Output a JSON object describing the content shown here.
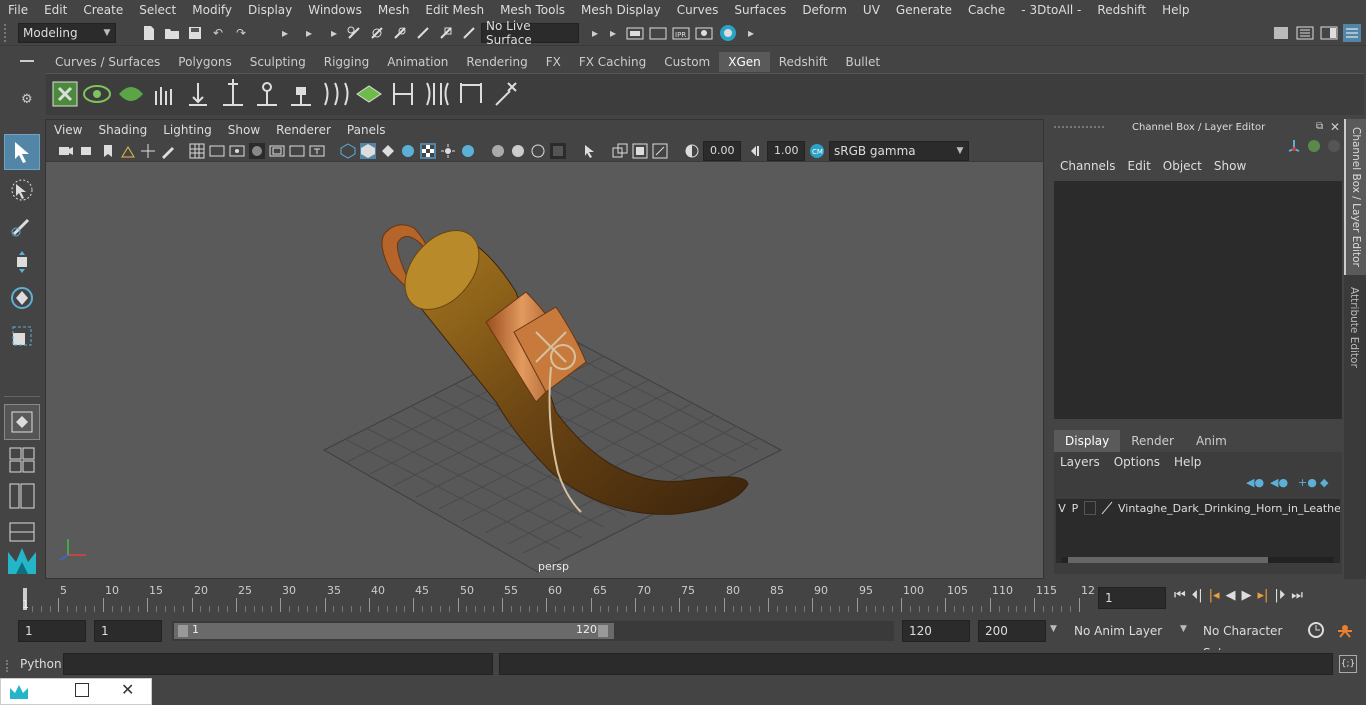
{
  "menubar": [
    "File",
    "Edit",
    "Create",
    "Select",
    "Modify",
    "Display",
    "Windows",
    "Mesh",
    "Edit Mesh",
    "Mesh Tools",
    "Mesh Display",
    "Curves",
    "Surfaces",
    "Deform",
    "UV",
    "Generate",
    "Cache",
    "- 3DtoAll -",
    "Redshift",
    "Help"
  ],
  "status": {
    "mode": "Modeling",
    "live_surface": "No Live Surface"
  },
  "shelf_tabs": [
    "Curves / Surfaces",
    "Polygons",
    "Sculpting",
    "Rigging",
    "Animation",
    "Rendering",
    "FX",
    "FX Caching",
    "Custom",
    "XGen",
    "Redshift",
    "Bullet"
  ],
  "shelf_active": "XGen",
  "viewport": {
    "menu": [
      "View",
      "Shading",
      "Lighting",
      "Show",
      "Renderer",
      "Panels"
    ],
    "exposure": "0.00",
    "gamma": "1.00",
    "colorspace": "sRGB gamma",
    "camera_label": "persp"
  },
  "channel_box": {
    "title": "Channel Box / Layer Editor",
    "menu": [
      "Channels",
      "Edit",
      "Object",
      "Show"
    ],
    "layer_tabs": [
      "Display",
      "Render",
      "Anim"
    ],
    "layer_tab_active": "Display",
    "layer_menu": [
      "Layers",
      "Options",
      "Help"
    ],
    "layer": {
      "v": "V",
      "p": "P",
      "name": "Vintaghe_Dark_Drinking_Horn_in_Leather_C"
    }
  },
  "side_tabs": [
    "Channel Box / Layer Editor",
    "Attribute Editor"
  ],
  "timeline": {
    "ticks": [
      "5",
      "10",
      "15",
      "20",
      "25",
      "30",
      "35",
      "40",
      "45",
      "50",
      "55",
      "60",
      "65",
      "70",
      "75",
      "80",
      "85",
      "90",
      "95",
      "100",
      "105",
      "110",
      "115",
      "12"
    ],
    "start_marker": "1",
    "current_frame": "1"
  },
  "range": {
    "start": "1",
    "playback_start": "1",
    "slider_start": "1",
    "slider_end": "120",
    "playback_end": "120",
    "end": "200",
    "anim_layer": "No Anim Layer",
    "char_set": "No Character Set"
  },
  "cmd": {
    "label": "Python"
  },
  "colors": {
    "accent": "#5285a6",
    "bg": "#444444",
    "viewport": "#5a5a5a",
    "horn": "#8a5a1c",
    "leather": "#b5642a"
  }
}
